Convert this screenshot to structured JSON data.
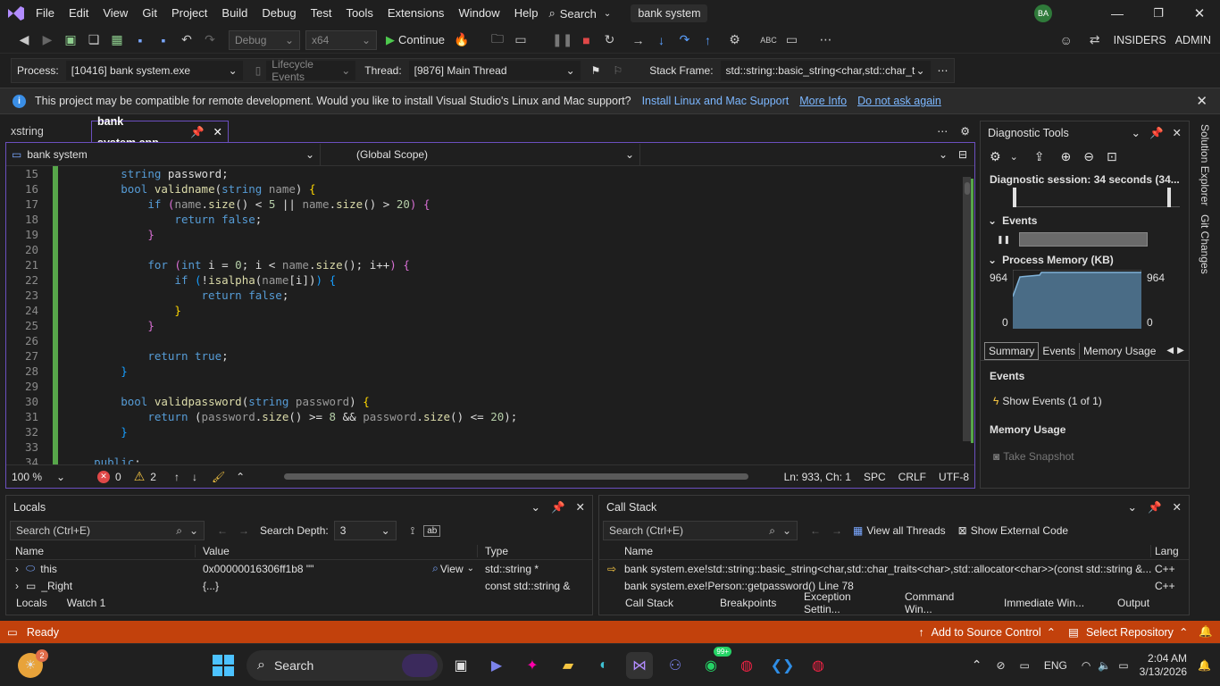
{
  "menu": {
    "items": [
      "File",
      "Edit",
      "View",
      "Git",
      "Project",
      "Build",
      "Debug",
      "Test",
      "Tools",
      "Extensions",
      "Window",
      "Help"
    ],
    "search_label": "Search",
    "solution_name": "bank system",
    "avatar_initials": "BA"
  },
  "toolbar": {
    "config": "Debug",
    "platform": "x64",
    "continue_label": "Continue",
    "insiders_label": "INSIDERS",
    "admin_label": "ADMIN"
  },
  "debugbar": {
    "process_label": "Process:",
    "process_value": "[10416] bank system.exe",
    "lifecycle_label": "Lifecycle Events",
    "thread_label": "Thread:",
    "thread_value": "[9876] Main Thread",
    "stackframe_label": "Stack Frame:",
    "stackframe_value": "std::string::basic_string<char,std::char_t"
  },
  "infobar": {
    "message": "This project may be compatible for remote development. Would you like to install Visual Studio's Linux and Mac support?",
    "link1": "Install Linux and Mac Support",
    "link2": "More Info",
    "link3": "Do not ask again"
  },
  "tabs": {
    "tab1": "xstring",
    "tab2": "bank system.cpp"
  },
  "navbar": {
    "project": "bank system",
    "scope": "(Global Scope)",
    "member": ""
  },
  "editor": {
    "zoom": "100 %",
    "errors": "0",
    "warnings": "2",
    "position": "Ln: 933, Ch: 1",
    "spc": "SPC",
    "crlf": "CRLF",
    "encoding": "UTF-8"
  },
  "code_lines": [
    {
      "n": "15",
      "html": "        <span class='kw'>string</span> password;"
    },
    {
      "n": "16",
      "html": "        <span class='kw'>bool</span> <span class='fn'>validname</span>(<span class='kw'>string</span> <span class='pm'>name</span>) <span class='br1'>{</span>"
    },
    {
      "n": "17",
      "html": "            <span class='kw'>if</span> <span class='br2'>(</span><span class='pm'>name</span>.<span class='fn'>size</span>() &lt; <span class='nu'>5</span> || <span class='pm'>name</span>.<span class='fn'>size</span>() &gt; <span class='nu'>20</span><span class='br2'>)</span> <span class='br2'>{</span>"
    },
    {
      "n": "18",
      "html": "                <span class='kw'>return</span> <span class='kw'>false</span>;"
    },
    {
      "n": "19",
      "html": "            <span class='br2'>}</span>"
    },
    {
      "n": "20",
      "html": ""
    },
    {
      "n": "21",
      "html": "            <span class='kw'>for</span> <span class='br2'>(</span><span class='kw'>int</span> i = <span class='nu'>0</span>; i &lt; <span class='pm'>name</span>.<span class='fn'>size</span>(); i++<span class='br2'>)</span> <span class='br2'>{</span>"
    },
    {
      "n": "22",
      "html": "                <span class='kw'>if</span> <span class='br3'>(</span>!<span class='fn'>isalpha</span>(<span class='pm'>name</span>[i])<span class='br3'>)</span> <span class='br3'>{</span>"
    },
    {
      "n": "23",
      "html": "                    <span class='kw'>return</span> <span class='kw'>false</span>;"
    },
    {
      "n": "24",
      "html": "                <span class='br1'>}</span>"
    },
    {
      "n": "25",
      "html": "            <span class='br2'>}</span>"
    },
    {
      "n": "26",
      "html": ""
    },
    {
      "n": "27",
      "html": "            <span class='kw'>return</span> <span class='kw'>true</span>;"
    },
    {
      "n": "28",
      "html": "        <span class='br3'>}</span>"
    },
    {
      "n": "29",
      "html": ""
    },
    {
      "n": "30",
      "html": "        <span class='kw'>bool</span> <span class='fn'>validpassword</span>(<span class='kw'>string</span> <span class='pm'>password</span>) <span class='br1'>{</span>"
    },
    {
      "n": "31",
      "html": "            <span class='kw'>return</span> (<span class='pm'>password</span>.<span class='fn'>size</span>() &gt;= <span class='nu'>8</span> &amp;&amp; <span class='pm'>password</span>.<span class='fn'>size</span>() &lt;= <span class='nu'>20</span>);"
    },
    {
      "n": "32",
      "html": "        <span class='br3'>}</span>"
    },
    {
      "n": "33",
      "html": ""
    },
    {
      "n": "34",
      "html": "    <span class='kw'>public</span>:"
    }
  ],
  "diagnostics": {
    "title": "Diagnostic Tools",
    "session": "Diagnostic session: 34 seconds (34...",
    "events_label": "Events",
    "memory_label": "Process Memory (KB)",
    "mem_max_left": "964",
    "mem_min_left": "0",
    "mem_max_right": "964",
    "mem_min_right": "0",
    "tabs": [
      "Summary",
      "Events",
      "Memory Usage"
    ],
    "events_section": "Events",
    "show_events": "Show Events (1 of 1)",
    "memory_section": "Memory Usage",
    "take_snapshot": "Take Snapshot"
  },
  "side": {
    "solution_explorer": "Solution Explorer",
    "git_changes": "Git Changes"
  },
  "locals": {
    "title": "Locals",
    "search_placeholder": "Search (Ctrl+E)",
    "depth_label": "Search Depth:",
    "depth_value": "3",
    "col_name": "Name",
    "col_value": "Value",
    "col_type": "Type",
    "rows": [
      {
        "name": "this",
        "value": "0x00000016306ff1b8 \"\"",
        "view": "View",
        "type": "std::string *"
      },
      {
        "name": "_Right",
        "value": "{...}",
        "view": "",
        "type": "const std::string &"
      }
    ],
    "tab1": "Locals",
    "tab2": "Watch 1"
  },
  "callstack": {
    "title": "Call Stack",
    "search_placeholder": "Search (Ctrl+E)",
    "view_threads": "View all Threads",
    "show_external": "Show External Code",
    "col_name": "Name",
    "col_lang": "Lang",
    "rows": [
      {
        "name": "bank system.exe!std::string::basic_string<char,std::char_traits<char>,std::allocator<char>>(const std::string &...",
        "lang": "C++"
      },
      {
        "name": "bank system.exe!Person::getpassword() Line 78",
        "lang": "C++"
      }
    ],
    "tabs": [
      "Call Stack",
      "Breakpoints",
      "Exception Settin...",
      "Command Win...",
      "Immediate Win...",
      "Output"
    ]
  },
  "status": {
    "ready": "Ready",
    "source_control": "Add to Source Control",
    "repository": "Select Repository"
  },
  "taskbar": {
    "search": "Search",
    "lang": "ENG",
    "time": "2:04 AM",
    "date": "3/13/2026",
    "badge_weather": "2",
    "badge_whatsapp": "99+"
  },
  "colors": {
    "accent": "#6b4fbf",
    "status_bar": "#c2410c",
    "change_bar": "#57a64a"
  }
}
